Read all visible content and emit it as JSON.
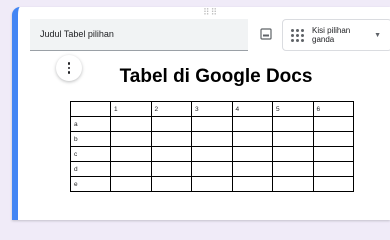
{
  "card": {
    "accent_color": "#4285f4"
  },
  "title_input": {
    "value": "Judul Tabel pilihan"
  },
  "question_type": {
    "selected": "Kisi pilihan ganda"
  },
  "document": {
    "title": "Tabel di Google Docs"
  },
  "table": {
    "columns": [
      "",
      "1",
      "2",
      "3",
      "4",
      "5",
      "6"
    ],
    "rows": [
      "a",
      "b",
      "c",
      "d",
      "e"
    ]
  },
  "icons": {
    "drag": "drag-handle-icon",
    "image": "image-icon",
    "grid": "grid-icon",
    "dropdown": "caret-down-icon",
    "more": "more-vert-icon"
  }
}
